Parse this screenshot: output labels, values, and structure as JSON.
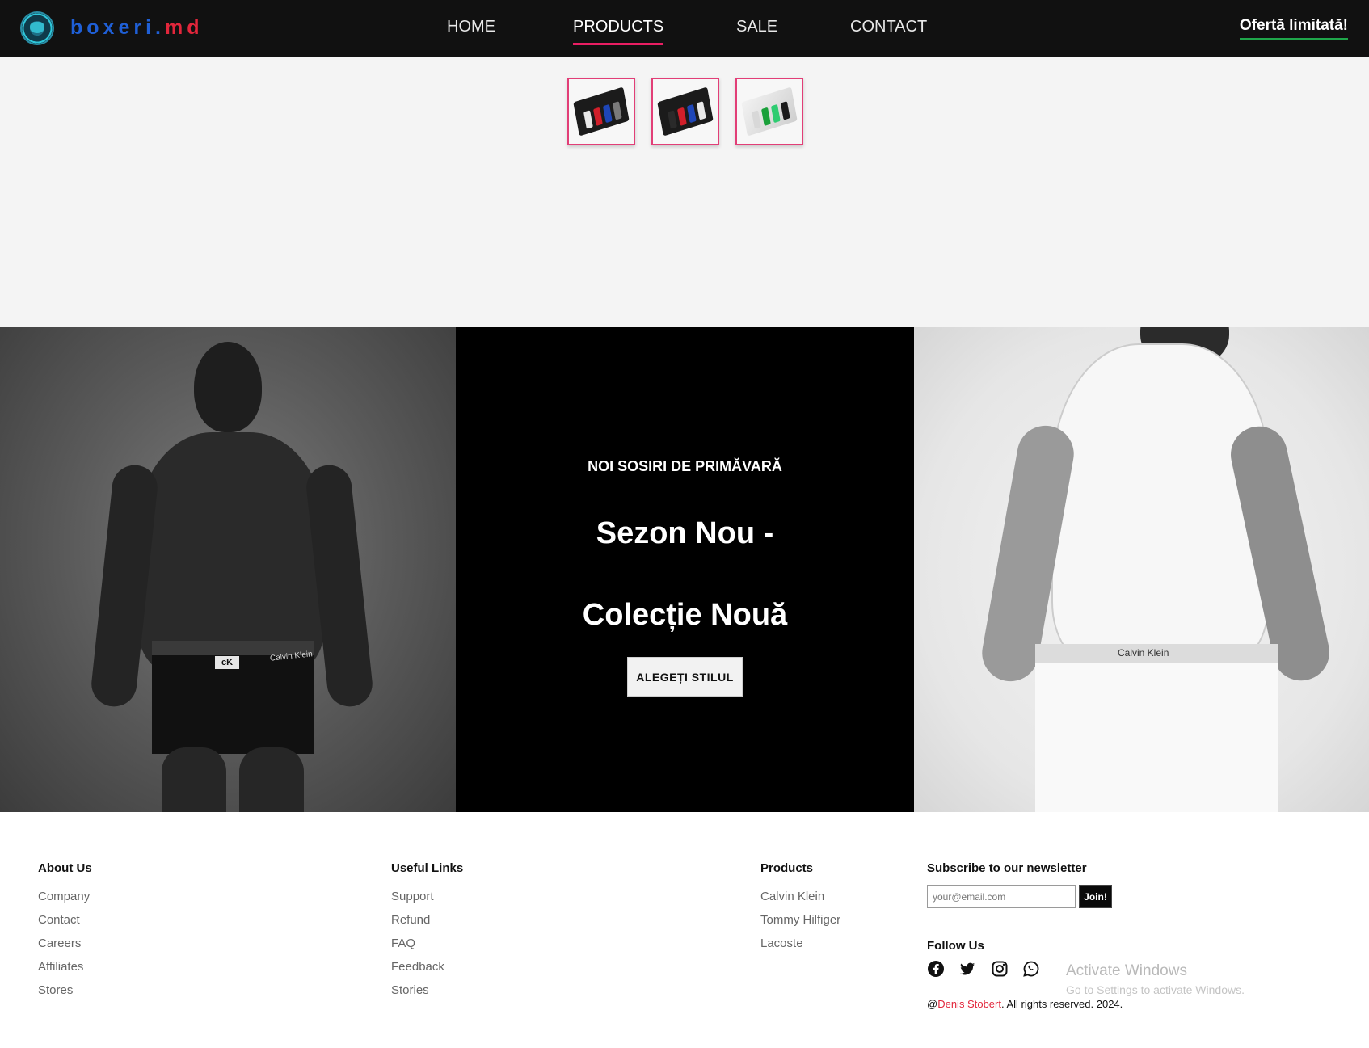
{
  "header": {
    "brand_part1": "boxeri.",
    "brand_part2": "md",
    "nav": [
      "HOME",
      "PRODUCTS",
      "SALE",
      "CONTACT"
    ],
    "active_nav": "PRODUCTS",
    "offer_label": "Ofertă limitată!"
  },
  "thumbnails": [
    {
      "box": "dark",
      "stripes": [
        "#e8e8e8",
        "#d11f2a",
        "#1e46b8",
        "#7a7a7a"
      ]
    },
    {
      "box": "dark",
      "stripes": [
        "#2a2a2a",
        "#d11f2a",
        "#1e46b8",
        "#e8e8e8"
      ]
    },
    {
      "box": "light",
      "stripes": [
        "#d8d8d8",
        "#1aa03a",
        "#2ecc71",
        "#1b1b1b"
      ]
    }
  ],
  "hero": {
    "kicker": "NOI SOSIRI DE PRIMĂVARĂ",
    "title_line1": "Sezon Nou -",
    "title_line2": "Colecție Nouă",
    "cta_label": "ALEGEȚI STILUL",
    "left_waistband_text": "Calvin Klein",
    "left_waistband_logo": "cK",
    "right_waistband_text": "Calvin Klein"
  },
  "footer": {
    "about": {
      "title": "About Us",
      "links": [
        "Company",
        "Contact",
        "Careers",
        "Affiliates",
        "Stores"
      ]
    },
    "useful": {
      "title": "Useful Links",
      "links": [
        "Support",
        "Refund",
        "FAQ",
        "Feedback",
        "Stories"
      ]
    },
    "products": {
      "title": "Products",
      "links": [
        "Calvin Klein",
        "Tommy Hilfiger",
        "Lacoste"
      ]
    },
    "newsletter": {
      "title": "Subscribe to our newsletter",
      "placeholder": "your@email.com",
      "button_label": "Join!"
    },
    "follow_title": "Follow Us",
    "social": [
      "facebook-icon",
      "twitter-icon",
      "instagram-icon",
      "whatsapp-icon"
    ],
    "copyright_prefix": "@",
    "copyright_author": "Denis Stobert",
    "copyright_suffix": ". All rights reserved. 2024."
  },
  "os_overlay": {
    "title": "Activate Windows",
    "subtitle": "Go to Settings to activate Windows."
  },
  "colors": {
    "accent_pink": "#e91e63",
    "brand_blue": "#1f5fd6",
    "brand_red": "#e2263b",
    "offer_underline": "#1fa64a"
  }
}
